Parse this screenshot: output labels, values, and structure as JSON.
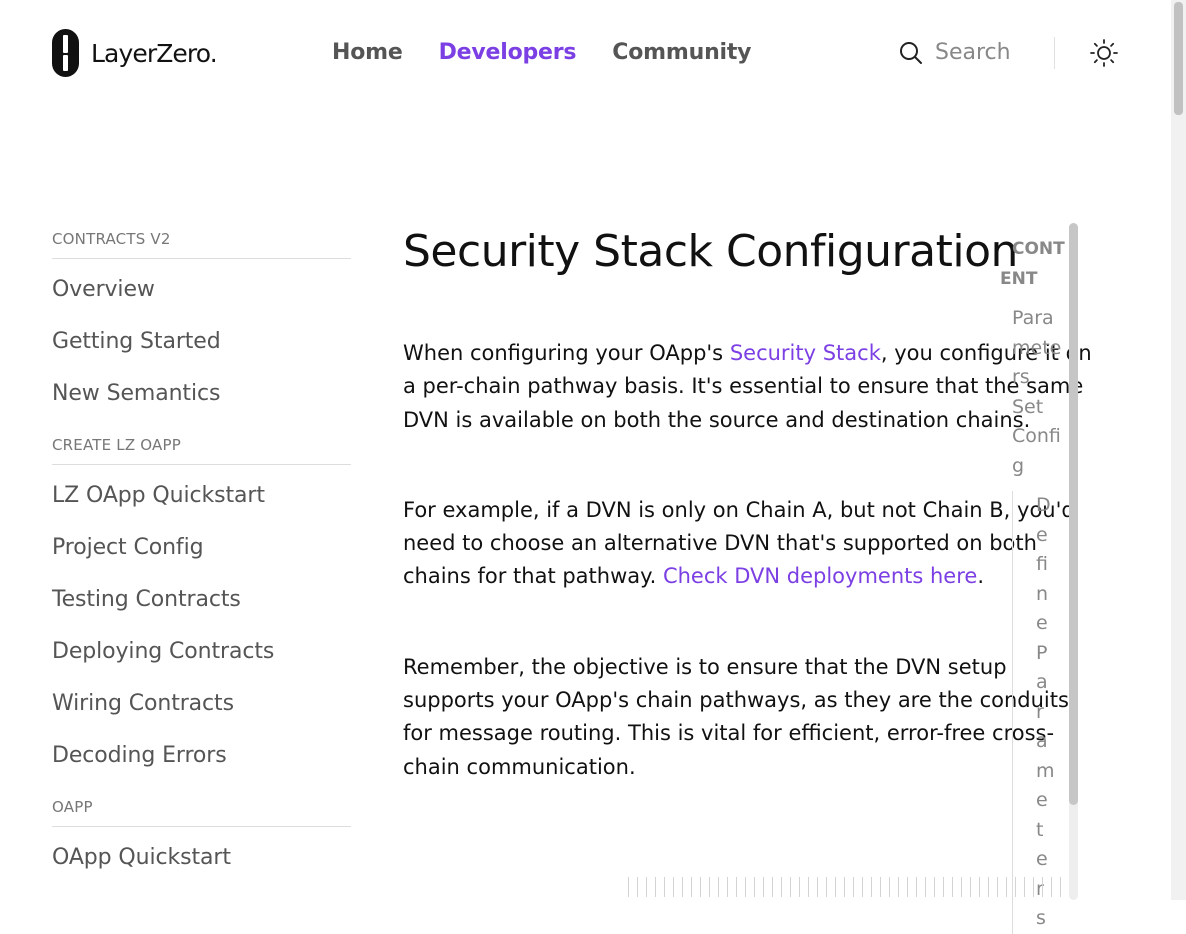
{
  "brand": {
    "name": "LayerZero."
  },
  "nav": {
    "items": [
      "Home",
      "Developers",
      "Community"
    ]
  },
  "search": {
    "placeholder": "Search"
  },
  "icons": {
    "search": "search-icon",
    "theme": "sun-icon",
    "logo": "layerzero-logo-icon"
  },
  "colors": {
    "accent": "#7b3fe4",
    "text": "#111111",
    "muted": "#555555"
  },
  "sidebar": {
    "sections": [
      {
        "title": "CONTRACTS V2",
        "items": [
          "Overview",
          "Getting Started",
          "New Semantics"
        ]
      },
      {
        "title": "CREATE LZ OAPP",
        "items": [
          "LZ OApp Quickstart",
          "Project Config",
          "Testing Contracts",
          "Deploying Contracts",
          "Wiring Contracts",
          "Decoding Errors"
        ]
      },
      {
        "title": "OAPP",
        "items": [
          "OApp Quickstart"
        ]
      }
    ]
  },
  "main": {
    "title": "Security Stack Configuration",
    "p1": {
      "before": "When configuring your OApp's ",
      "link": "Security Stack",
      "after": ", you configure it on a per-chain pathway basis. It's essential to ensure that the same DVN is available on both the source and destination chains."
    },
    "p2": {
      "before": "For example, if a DVN is only on Chain A, but not Chain B, you'd need to choose an alternative DVN that's supported on both chains for that pathway. ",
      "link": "Check DVN deployments here",
      "after": "."
    },
    "p3": "Remember, the objective is to ensure that the DVN setup supports your OApp's chain pathways, as they are the conduits for message routing. This is vital for efficient, error-free cross-chain communication."
  },
  "toc": {
    "title_a": "CONT",
    "title_b": "ENT",
    "items": [
      "Parameters",
      "Set Config"
    ],
    "subitem": "Define Parameters"
  }
}
